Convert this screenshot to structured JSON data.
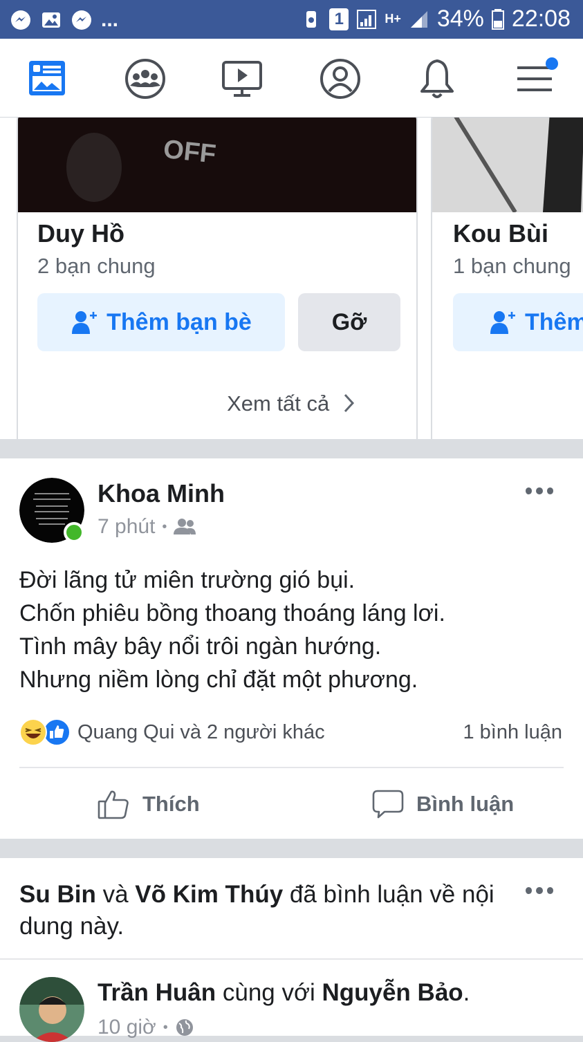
{
  "status_bar": {
    "battery": "34%",
    "time": "22:08",
    "network": "H+",
    "sim_slot": "1",
    "more": "..."
  },
  "nav": {
    "items": [
      "news-feed",
      "groups",
      "watch",
      "profile",
      "notifications",
      "menu"
    ]
  },
  "pymk": {
    "cards": [
      {
        "name": "Duy Hồ",
        "mutual": "2 bạn chung",
        "add_label": "Thêm bạn bè",
        "remove_label": "Gỡ",
        "photo_text": "OFF"
      },
      {
        "name": "Kou Bùi",
        "mutual": "1 bạn chung",
        "add_label": "Thêm"
      }
    ],
    "see_all": "Xem tất cả"
  },
  "post": {
    "author": "Khoa Minh",
    "time": "7 phút",
    "separator": "•",
    "lines": [
      "Đời lãng tử miên trường gió bụi.",
      "Chốn phiêu bồng thoang thoáng láng lơi.",
      "Tình mây bây nổi trôi ngàn hướng.",
      "Nhưng niềm lòng chỉ đặt một phương."
    ],
    "reactors": "Quang Qui và 2 người khác",
    "comments": "1 bình luận",
    "like_label": "Thích",
    "comment_label": "Bình luận",
    "accent_color": "#1877f2",
    "online_color": "#42b72a"
  },
  "post2": {
    "actor1": "Su Bin",
    "and": "và",
    "actor2": "Võ Kim Thúy",
    "activity_rest": "đã bình luận về nội dung này.",
    "author": "Trần Huân",
    "with_text": "cùng với",
    "tagged": "Nguyễn Bảo",
    "period": ".",
    "time": "10 giờ",
    "separator": "•"
  }
}
